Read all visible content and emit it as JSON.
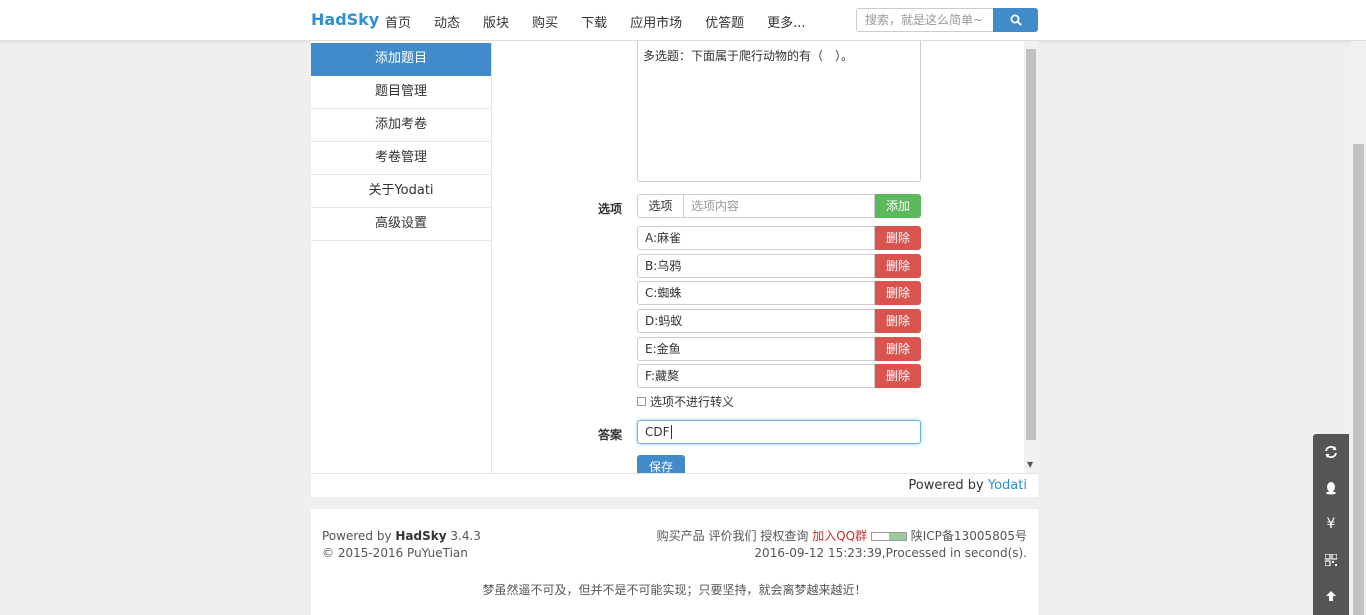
{
  "navbar": {
    "brand": "HadSky",
    "links": [
      "首页",
      "动态",
      "版块",
      "购买",
      "下载",
      "应用市场",
      "优答题",
      "更多..."
    ],
    "search_placeholder": "搜索，就是这么简单~"
  },
  "sidebar": {
    "items": [
      {
        "label": "添加题目",
        "active": true
      },
      {
        "label": "题目管理"
      },
      {
        "label": "添加考卷"
      },
      {
        "label": "考卷管理"
      },
      {
        "label": "关于Yodati"
      },
      {
        "label": "高级设置"
      }
    ]
  },
  "form": {
    "question_text": "多选题：下面属于爬行动物的有（　）。",
    "options_label": "选项",
    "option_addon": "选项",
    "option_placeholder": "选项内容",
    "add_label": "添加",
    "delete_label": "删除",
    "options": [
      "A:麻雀",
      "B:乌鸦",
      "C:蜘蛛",
      "D:蚂蚁",
      "E:金鱼",
      "F:藏獒"
    ],
    "no_escape_label": "选项不进行转义",
    "answer_label": "答案",
    "answer_value": "CDF",
    "save_label": "保存"
  },
  "powered": {
    "prefix": "Powered by ",
    "link": "Yodati"
  },
  "footer": {
    "powered_prefix": "Powered by ",
    "powered_name": "HadSky",
    "version": " 3.4.3",
    "copyright": "© 2015-2016 PuYueTian",
    "links": [
      "购买产品",
      "评价我们",
      "授权查询"
    ],
    "qq_group": "加入QQ群",
    "icp": "陕ICP备13005805号",
    "processed": "2016-09-12 15:23:39,Processed in second(s).",
    "motto": "梦虽然遥不可及，但并不是不可能实现；只要坚持，就会离梦越来越近！"
  },
  "colors": {
    "primary": "#428bca",
    "success": "#5cb85c",
    "danger": "#d9534f",
    "brand": "#2f8fd6"
  },
  "float_toolbar": [
    "refresh-icon",
    "qq-icon",
    "yen-icon",
    "qrcode-icon",
    "arrow-up-icon"
  ]
}
